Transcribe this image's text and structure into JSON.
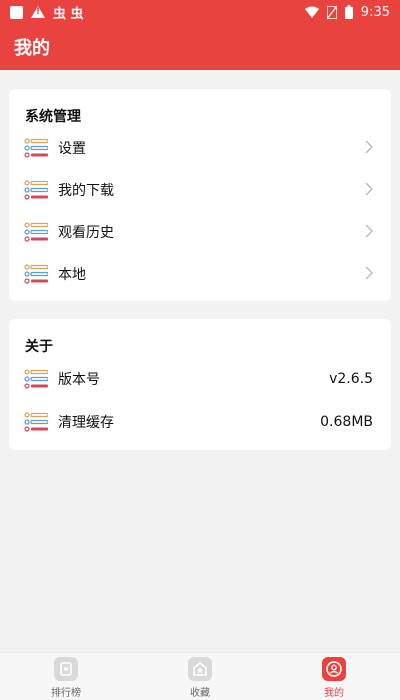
{
  "status_bar": {
    "time": "9:35",
    "bug_glyphs": "虫 虫"
  },
  "header": {
    "title": "我的"
  },
  "system_section": {
    "title": "系统管理",
    "items": [
      {
        "label": "设置"
      },
      {
        "label": "我的下载"
      },
      {
        "label": "观看历史"
      },
      {
        "label": "本地"
      }
    ]
  },
  "about_section": {
    "title": "关于",
    "items": [
      {
        "label": "版本号",
        "value": "v2.6.5"
      },
      {
        "label": "清理缓存",
        "value": "0.68MB"
      }
    ]
  },
  "tabbar": {
    "tabs": [
      {
        "label": "排行榜",
        "icon": "ranking-icon",
        "active": false
      },
      {
        "label": "收藏",
        "icon": "favorites-icon",
        "active": false
      },
      {
        "label": "我的",
        "icon": "profile-icon",
        "active": true
      }
    ]
  },
  "colors": {
    "accent": "#e8433e",
    "background": "#f2f2f2"
  }
}
